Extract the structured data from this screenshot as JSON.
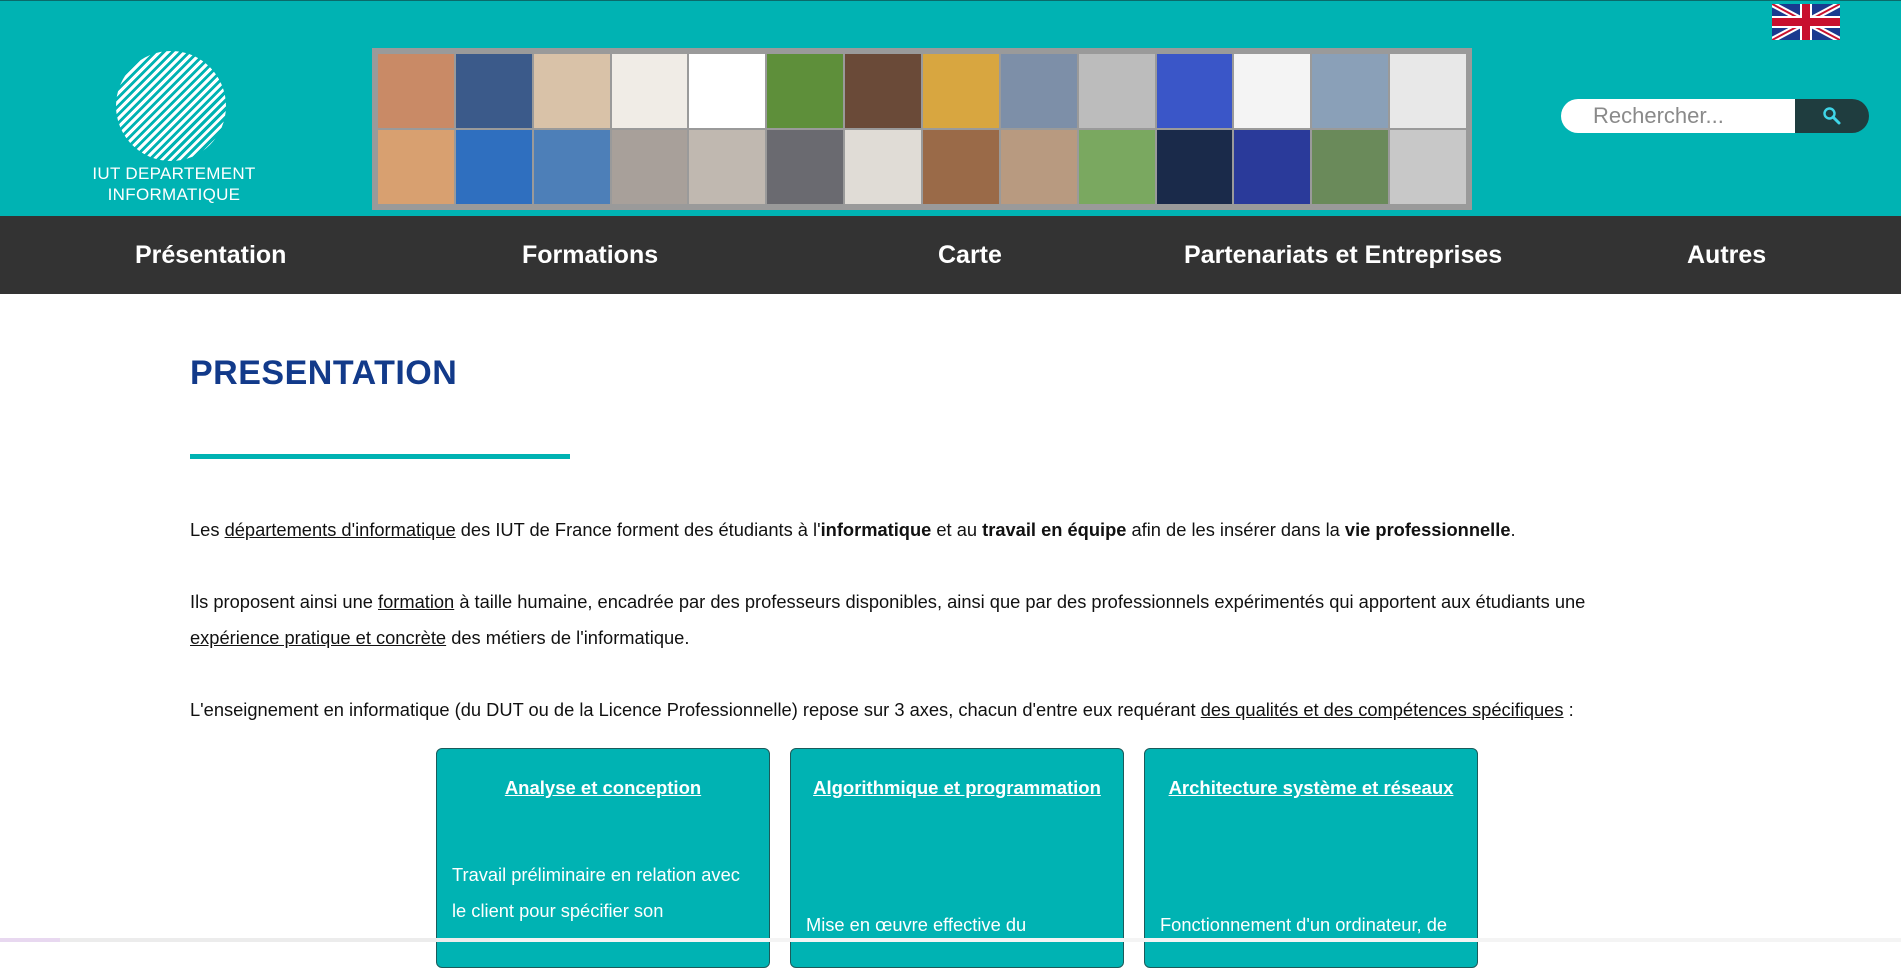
{
  "header": {
    "logo_text_line1": "IUT DEPARTEMENT",
    "logo_text_line2": "INFORMATIQUE",
    "language_flag": "uk-flag-icon",
    "search": {
      "placeholder": "Rechercher...",
      "value": ""
    }
  },
  "nav": {
    "items": [
      {
        "label": "Présentation"
      },
      {
        "label": "Formations"
      },
      {
        "label": "Carte"
      },
      {
        "label": "Partenariats et Entreprises"
      },
      {
        "label": "Autres"
      }
    ]
  },
  "main": {
    "title": "PRESENTATION",
    "p1": {
      "t1": "Les ",
      "link1": "départements d'informatique",
      "t2": " des IUT de France forment des étudiants à l'",
      "b1": "informatique",
      "t3": " et au ",
      "b2": "travail en équipe",
      "t4": " afin de les insérer dans la ",
      "b3": "vie professionnelle",
      "t5": "."
    },
    "p2": {
      "t1": "Ils proposent ainsi une ",
      "link1": "formation",
      "t2": " à taille humaine, encadrée par des professeurs disponibles, ainsi que par des professionnels expérimentés qui apportent aux étudiants une",
      "link2": "expérience pratique et concrète",
      "t3": " des métiers de l'informatique."
    },
    "p3": {
      "t1": "L'enseignement en informatique (du DUT ou de la Licence Professionnelle) repose sur 3 axes, chacun d'entre eux requérant ",
      "link1": "des qualités et des compétences spécifiques",
      "t2": " :"
    },
    "cards": [
      {
        "title": "Analyse et conception",
        "text": "Travail préliminaire en relation avec le client pour spécifier son"
      },
      {
        "title": "Algorithmique et programmation",
        "text": "Mise en œuvre effective du"
      },
      {
        "title": "Architecture système et réseaux",
        "text": "Fonctionnement d'un ordinateur, de"
      }
    ]
  },
  "colors": {
    "header_bg": "#00b3b3",
    "nav_bg": "#333333",
    "title": "#123a8a",
    "accent": "#00b3b3"
  }
}
